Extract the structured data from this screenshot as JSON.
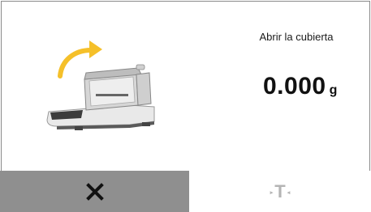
{
  "status": {
    "message": "Abrir la cubierta"
  },
  "weight": {
    "value": "0.000",
    "unit": "g"
  },
  "actions": {
    "cancel_icon": "close-icon",
    "tare_label": "T",
    "tare_left_marker": "▸",
    "tare_right_marker": "◂",
    "tare_icon": "tare-icon"
  },
  "illustration": {
    "icon": "balance-open-door-icon",
    "arrow_color": "#f5c02a"
  },
  "colors": {
    "cancel_background": "#8f8f8f",
    "tare_disabled": "#b4b4b4",
    "text": "#111111"
  }
}
